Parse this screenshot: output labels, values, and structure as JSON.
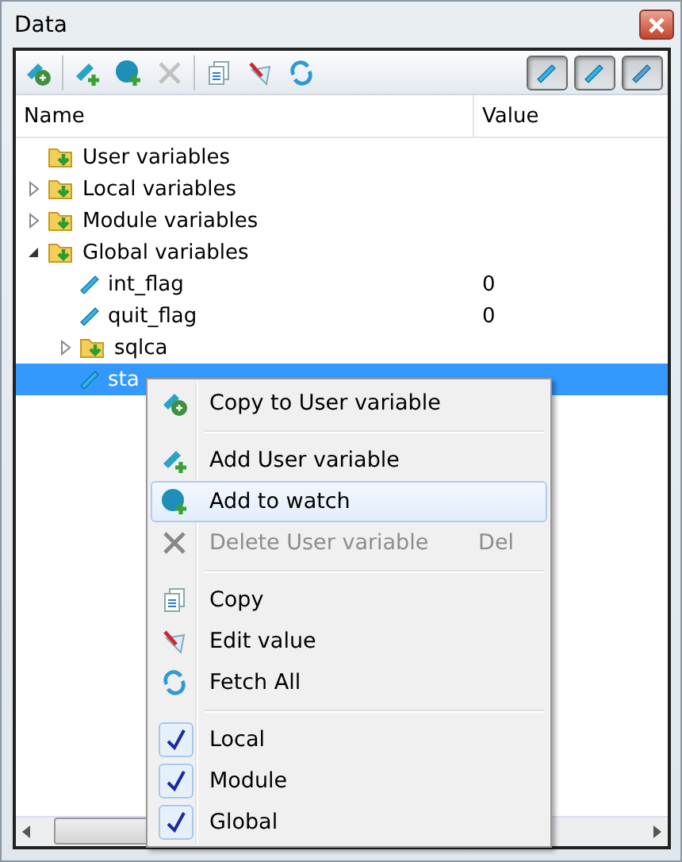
{
  "window": {
    "title": "Data"
  },
  "toolbar": {
    "buttons": [
      {
        "kind": "button",
        "disabled": false
      },
      {
        "kind": "separator"
      },
      {
        "kind": "button",
        "disabled": false
      },
      {
        "kind": "button",
        "disabled": false
      },
      {
        "kind": "button",
        "disabled": true
      },
      {
        "kind": "separator"
      },
      {
        "kind": "button",
        "disabled": false
      },
      {
        "kind": "button",
        "disabled": false
      },
      {
        "kind": "button",
        "disabled": false
      }
    ],
    "toggles": [
      {
        "pressed": true
      },
      {
        "pressed": true
      },
      {
        "pressed": true
      }
    ]
  },
  "table": {
    "columns": [
      "Name",
      "Value"
    ],
    "rows": [
      {
        "kind": "folder",
        "name": "User variables",
        "selected": false
      },
      {
        "kind": "folder",
        "name": "Local variables",
        "expanded": false,
        "selected": false
      },
      {
        "kind": "folder",
        "name": "Module variables",
        "expanded": false,
        "selected": false
      },
      {
        "kind": "folder",
        "name": "Global variables",
        "expanded": true,
        "selected": false,
        "children": [
          {
            "kind": "variable",
            "name": "int_flag",
            "value": "0",
            "selected": false
          },
          {
            "kind": "variable",
            "name": "quit_flag",
            "value": "0",
            "selected": false
          },
          {
            "kind": "folder",
            "name": "sqlca",
            "expanded": false,
            "selected": false
          },
          {
            "kind": "variable",
            "name": "sta",
            "selected": true
          }
        ]
      }
    ]
  },
  "context_menu": {
    "items": [
      {
        "kind": "command",
        "label": "Copy to User variable",
        "hovered": false,
        "disabled": false
      },
      {
        "kind": "separator"
      },
      {
        "kind": "command",
        "label": "Add User variable",
        "hovered": false,
        "disabled": false
      },
      {
        "kind": "command",
        "label": "Add to watch",
        "hovered": true,
        "disabled": false
      },
      {
        "kind": "command",
        "label": "Delete User variable",
        "shortcut": "Del",
        "hovered": false,
        "disabled": true
      },
      {
        "kind": "separator"
      },
      {
        "kind": "command",
        "label": "Copy",
        "hovered": false,
        "disabled": false
      },
      {
        "kind": "command",
        "label": "Edit value",
        "hovered": false,
        "disabled": false
      },
      {
        "kind": "command",
        "label": "Fetch All",
        "hovered": false,
        "disabled": false
      },
      {
        "kind": "separator"
      },
      {
        "kind": "check",
        "label": "Local",
        "checked": true
      },
      {
        "kind": "check",
        "label": "Module",
        "checked": true
      },
      {
        "kind": "check",
        "label": "Global",
        "checked": true
      }
    ]
  }
}
